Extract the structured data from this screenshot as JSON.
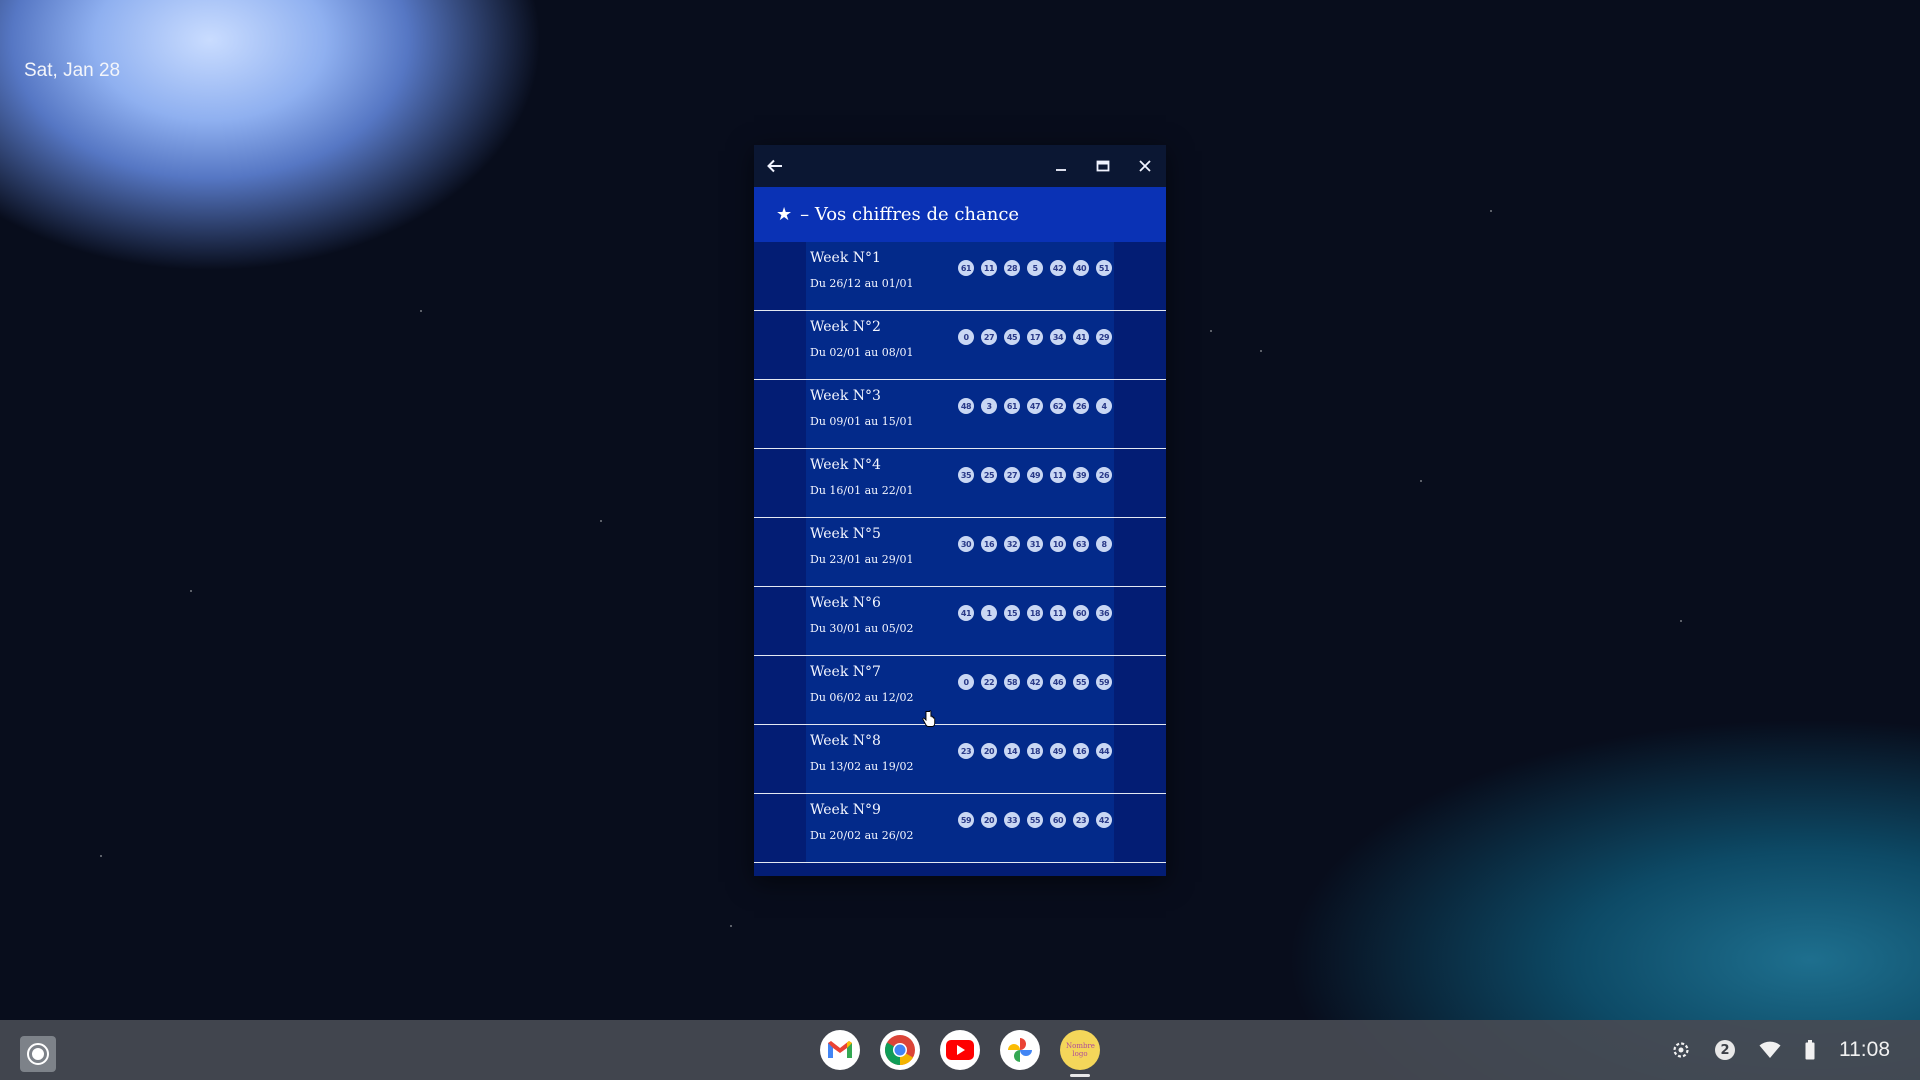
{
  "desktop": {
    "date": "Sat, Jan 28"
  },
  "window": {
    "header_star": "★",
    "header_title": "– Vos chiffres de chance"
  },
  "weeks": [
    {
      "title": "Week N°1",
      "range": "Du 26/12 au 01/01",
      "numbers": [
        "61",
        "11",
        "28",
        "5",
        "42",
        "40",
        "51"
      ]
    },
    {
      "title": "Week N°2",
      "range": "Du 02/01 au 08/01",
      "numbers": [
        "0",
        "27",
        "45",
        "17",
        "34",
        "41",
        "29"
      ]
    },
    {
      "title": "Week N°3",
      "range": "Du 09/01 au 15/01",
      "numbers": [
        "48",
        "3",
        "61",
        "47",
        "62",
        "26",
        "4"
      ]
    },
    {
      "title": "Week N°4",
      "range": "Du 16/01 au 22/01",
      "numbers": [
        "35",
        "25",
        "27",
        "49",
        "11",
        "39",
        "26"
      ]
    },
    {
      "title": "Week N°5",
      "range": "Du 23/01 au 29/01",
      "numbers": [
        "30",
        "16",
        "32",
        "31",
        "10",
        "63",
        "8"
      ]
    },
    {
      "title": "Week N°6",
      "range": "Du 30/01 au 05/02",
      "numbers": [
        "41",
        "1",
        "15",
        "18",
        "11",
        "60",
        "36"
      ]
    },
    {
      "title": "Week N°7",
      "range": "Du 06/02 au 12/02",
      "numbers": [
        "0",
        "22",
        "58",
        "42",
        "46",
        "55",
        "59"
      ]
    },
    {
      "title": "Week N°8",
      "range": "Du 13/02 au 19/02",
      "numbers": [
        "23",
        "20",
        "14",
        "18",
        "49",
        "16",
        "44"
      ]
    },
    {
      "title": "Week N°9",
      "range": "Du 20/02 au 26/02",
      "numbers": [
        "59",
        "20",
        "33",
        "55",
        "60",
        "23",
        "42"
      ]
    }
  ],
  "shelf": {
    "apps": [
      "gmail-icon",
      "chrome-icon",
      "youtube-icon",
      "photos-icon",
      "custom-app-icon"
    ],
    "custom_app_label": "Nombre logo",
    "notification_count": "2",
    "time": "11:08"
  },
  "colors": {
    "window_bg": "#031d74",
    "header_bg": "#0a32b5",
    "titlebar_bg": "#0b1733"
  }
}
